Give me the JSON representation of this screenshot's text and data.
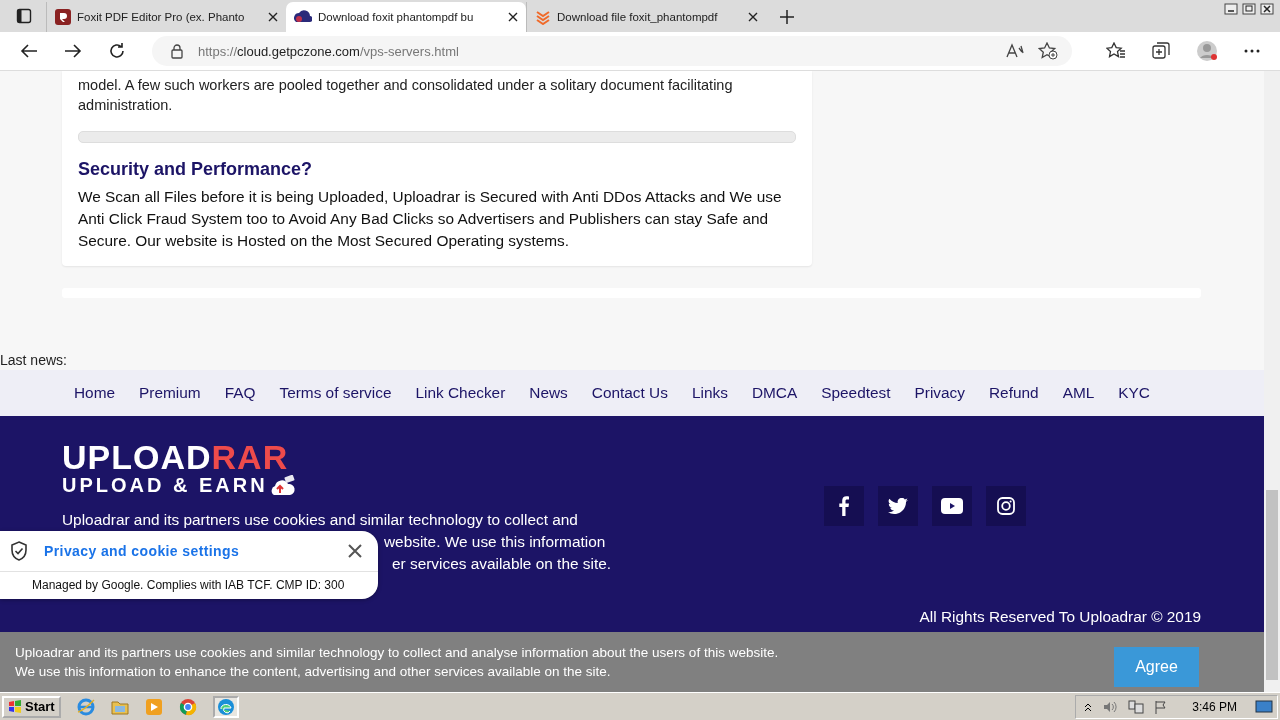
{
  "browser": {
    "tabs": [
      {
        "title": "Foxit PDF Editor Pro (ex. Phanto",
        "selected": false
      },
      {
        "title": "Download foxit phantompdf bu",
        "selected": true
      },
      {
        "title": "Download file foxit_phantompdf",
        "selected": false
      }
    ],
    "url": {
      "scheme": "https://",
      "host": "cloud.getpczone.com",
      "path": "/vps-servers.html"
    }
  },
  "article": {
    "intro": "model. A few such workers are pooled together and consolidated under a solitary document facilitating administration.",
    "heading": "Security and Performance?",
    "body": "We Scan all Files before it is being Uploaded, Uploadrar is Secured with Anti DDos Attacks and We use Anti Click Fraud System too to Avoid Any Bad Clicks so Advertisers and Publishers can stay Safe and Secure. Our website is Hosted on the Most Secured Operating systems."
  },
  "last_news_label": "Last news:",
  "nav": [
    "Home",
    "Premium",
    "FAQ",
    "Terms of service",
    "Link Checker",
    "News",
    "Contact Us",
    "Links",
    "DMCA",
    "Speedtest",
    "Privacy",
    "Refund",
    "AML",
    "KYC"
  ],
  "footer": {
    "logo": {
      "white": "UPLOAD",
      "red": "RAR",
      "tagline": "UPLOAD & EARN"
    },
    "text_lines": [
      "Uploadrar and its partners use cookies and similar technology to collect and",
      "website. We use this information",
      "er services available on the site."
    ],
    "copyright": "All Rights Reserved To Uploadrar © 2019"
  },
  "privacy_popup": {
    "title": "Privacy and cookie settings",
    "note": "Managed by Google. Complies with IAB TCF. CMP ID: 300"
  },
  "cookie_bar": {
    "lines": [
      "Uploadrar and its partners use cookies and similar technology to collect and analyse information about the users of this website.",
      "We use this information to enhance the content, advertising and other services available on the site."
    ],
    "button": "Agree"
  },
  "taskbar": {
    "start": "Start",
    "clock": "3:46 PM"
  }
}
